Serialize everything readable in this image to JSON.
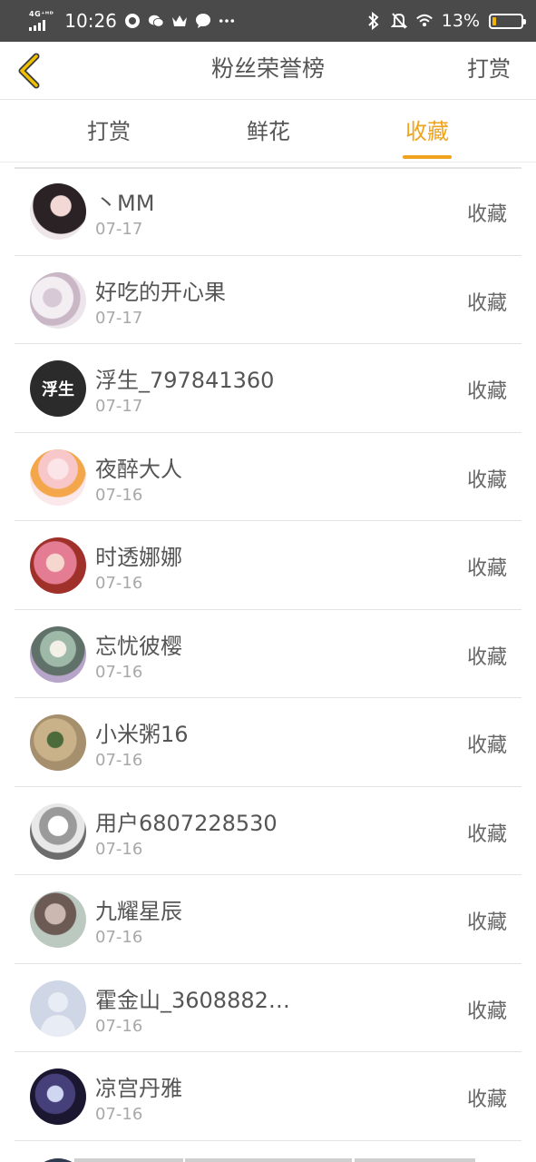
{
  "status_bar": {
    "network": "4G⁺ᴴᴰ",
    "time": "10:26",
    "battery_percent": "13%",
    "battery_level": 0.13,
    "accent_battery": "#f2b400"
  },
  "header": {
    "title": "粉丝荣誉榜",
    "action_label": "打赏",
    "back_icon": "chevron-left-icon",
    "accent": "#f0c000"
  },
  "tabs": [
    {
      "label": "打赏",
      "active": false
    },
    {
      "label": "鲜花",
      "active": false
    },
    {
      "label": "收藏",
      "active": true
    }
  ],
  "accent_color": "#f0a31c",
  "fans": [
    {
      "name": "丶MM",
      "date": "07-17",
      "action": "收藏"
    },
    {
      "name": "好吃的开心果",
      "date": "07-17",
      "action": "收藏"
    },
    {
      "name": "浮生_797841360",
      "date": "07-17",
      "action": "收藏",
      "avatar_text": "浮生"
    },
    {
      "name": "夜醉大人",
      "date": "07-16",
      "action": "收藏"
    },
    {
      "name": "时透娜娜",
      "date": "07-16",
      "action": "收藏"
    },
    {
      "name": "忘忧彼樱",
      "date": "07-16",
      "action": "收藏"
    },
    {
      "name": "小米粥16",
      "date": "07-16",
      "action": "收藏"
    },
    {
      "name": "用户6807228530",
      "date": "07-16",
      "action": "收藏"
    },
    {
      "name": "九耀星辰",
      "date": "07-16",
      "action": "收藏"
    },
    {
      "name": "霍金山_3608882…",
      "date": "07-16",
      "action": "收藏"
    },
    {
      "name": "凉宫丹雅",
      "date": "07-16",
      "action": "收藏"
    }
  ]
}
